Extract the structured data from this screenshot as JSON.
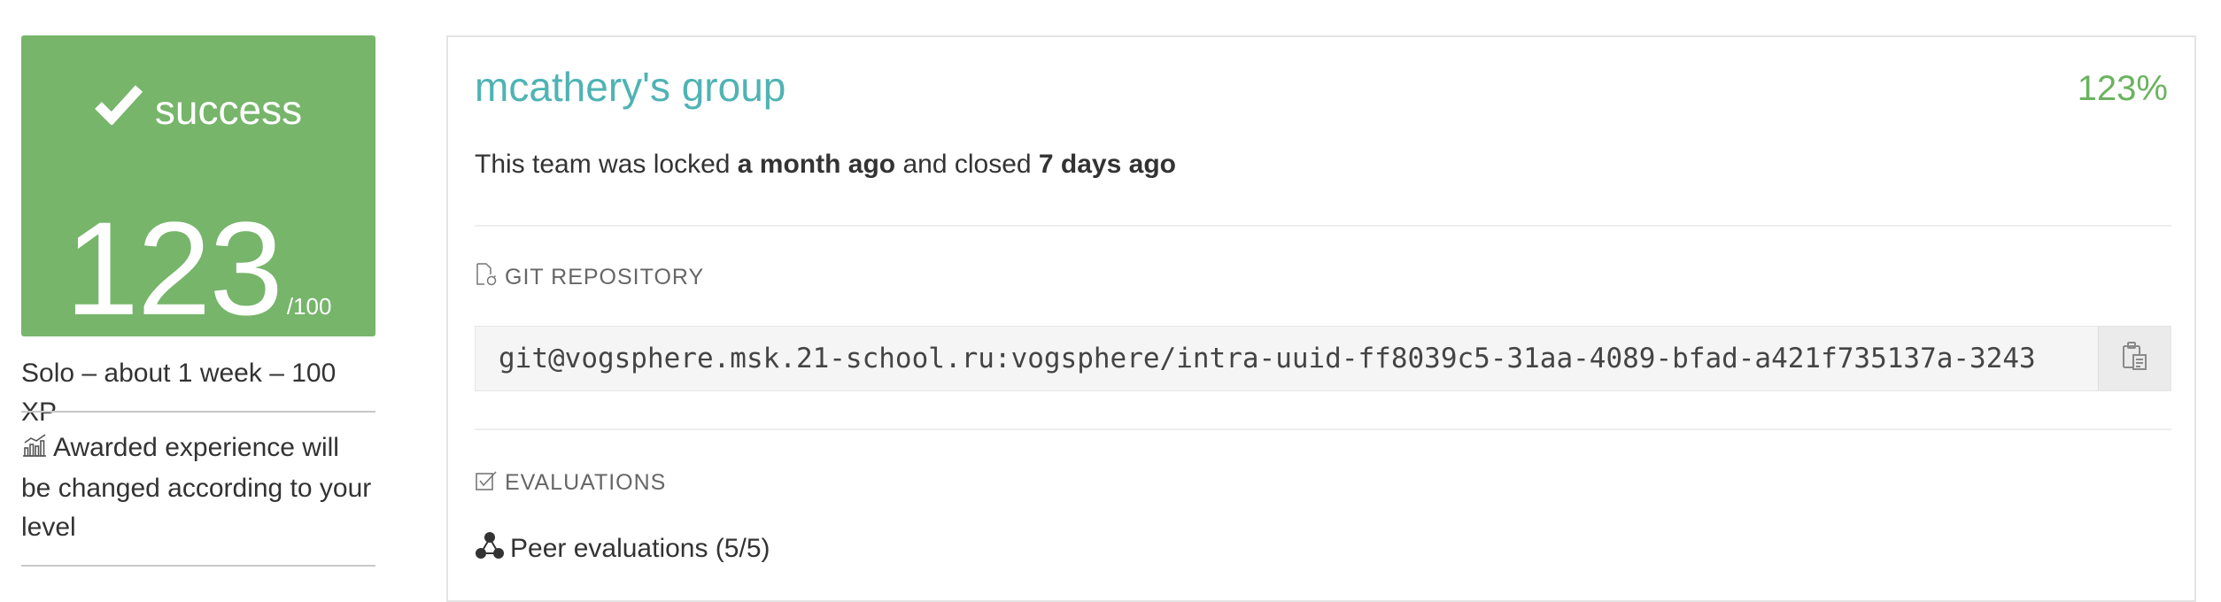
{
  "sidebar": {
    "status_label": "success",
    "score": "123",
    "score_max": "/100",
    "summary": "Solo – about 1 week – 100 XP",
    "awarded_note": "Awarded experience will be changed according to your level",
    "icons": {
      "status": "check-icon",
      "awarded": "chart-icon"
    },
    "colors": {
      "success_bg": "#76b56a"
    }
  },
  "main": {
    "group_title": "mcathery's group",
    "percent": "123%",
    "lock_info": {
      "prefix": "This team was locked ",
      "locked_when": "a month ago",
      "middle": " and closed ",
      "closed_when": "7 days ago"
    },
    "git_section": {
      "heading": "GIT REPOSITORY",
      "repo_url": "git@vogsphere.msk.21-school.ru:vogsphere/intra-uuid-ff8039c5-31aa-4089-bfad-a421f735137a-3243",
      "icons": {
        "heading": "git-file-icon",
        "copy": "clipboard-icon"
      }
    },
    "evaluations_section": {
      "heading": "EVALUATIONS",
      "peer_label": "Peer evaluations (5/5)",
      "icons": {
        "heading": "checkbox-icon",
        "peer": "people-group-icon"
      }
    },
    "colors": {
      "title": "#4fb3b4",
      "percent": "#6bb35f"
    }
  }
}
